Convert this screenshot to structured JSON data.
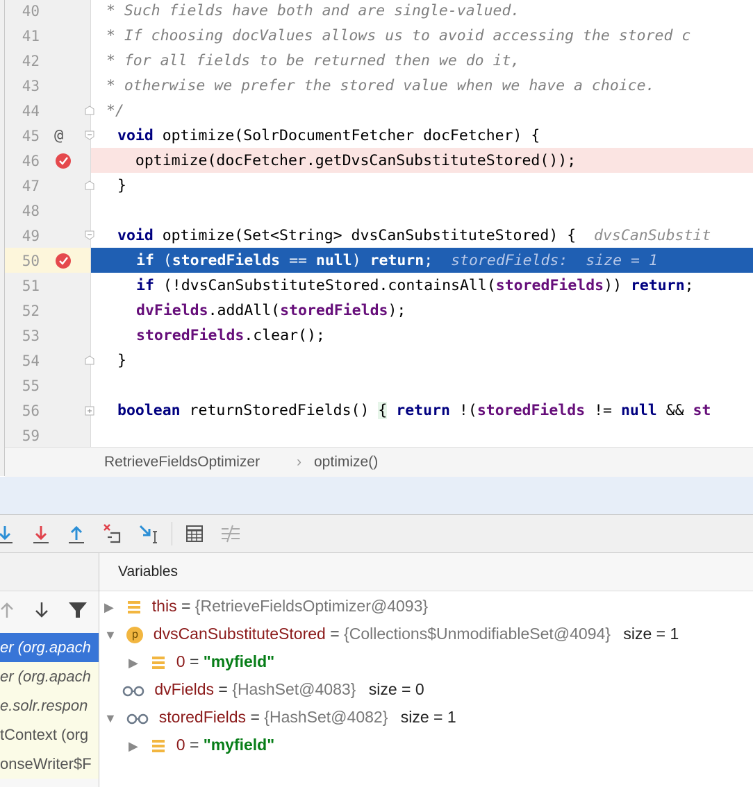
{
  "editor": {
    "lines": [
      {
        "num": "40",
        "type": "comment",
        "text": " * Such fields have both and are single-valued."
      },
      {
        "num": "41",
        "type": "comment",
        "text": " * If choosing docValues allows us to avoid accessing the stored c"
      },
      {
        "num": "42",
        "type": "comment",
        "text": " * for all fields to be returned then we do it,"
      },
      {
        "num": "43",
        "type": "comment",
        "text": " * otherwise we prefer the stored value when we have a choice."
      },
      {
        "num": "44",
        "type": "comment",
        "text": " */"
      },
      {
        "num": "45",
        "kw": "void",
        "rest": " optimize(SolrDocumentFetcher docFetcher) {"
      },
      {
        "num": "46",
        "text": "  optimize(docFetcher.getDvsCanSubstituteStored());"
      },
      {
        "num": "47",
        "text": "}"
      },
      {
        "num": "48",
        "text": ""
      },
      {
        "num": "49",
        "kw": "void",
        "rest": " optimize(Set<String> dvsCanSubstituteStored) {  ",
        "hint": "dvsCanSubstit"
      },
      {
        "num": "50"
      },
      {
        "num": "51"
      },
      {
        "num": "52"
      },
      {
        "num": "53"
      },
      {
        "num": "54",
        "text": "}"
      },
      {
        "num": "55",
        "text": ""
      },
      {
        "num": "56"
      },
      {
        "num": "59",
        "text": ""
      }
    ],
    "line50": {
      "if": "if",
      "p1": " (",
      "f1": "storedFields",
      "p2": " == ",
      "null": "null",
      "p3": ") ",
      "ret": "return",
      "p4": ";  ",
      "hint": "storedFields:  size = 1"
    },
    "line51": {
      "if": "if",
      "p1": " (!dvsCanSubstituteStored.containsAll(",
      "f1": "storedFields",
      "p2": ")) ",
      "ret": "return",
      "p3": ";"
    },
    "line52": {
      "f1": "dvFields",
      "p1": ".addAll(",
      "f2": "storedFields",
      "p2": ");"
    },
    "line53": {
      "f1": "storedFields",
      "p1": ".clear();"
    },
    "line56": {
      "kw": "boolean",
      "p1": " returnStoredFields() ",
      "brace": "{",
      "p2": " ",
      "ret": "return",
      "p3": " !(",
      "f1": "storedFields",
      "p4": " != ",
      "null": "null",
      "p5": " && ",
      "f2": "st"
    },
    "at_marker": "@"
  },
  "breadcrumb": {
    "class_name": "RetrieveFieldsOptimizer",
    "separator": "›",
    "method": "optimize()"
  },
  "variables_title": "Variables",
  "frames": [
    {
      "text": "er (org.apach",
      "selected": true
    },
    {
      "text": "er (org.apach",
      "selected": false
    },
    {
      "text": "e.solr.respon",
      "selected": false
    },
    {
      "text": "tContext (org",
      "selected": false
    },
    {
      "text": "onseWriter$F",
      "selected": false
    }
  ],
  "variables": [
    {
      "name": "this",
      "eq": " = ",
      "value": "{RetrieveFieldsOptimizer@4093}",
      "size": "",
      "icon": "field-icon",
      "expand": "collapsed"
    },
    {
      "name": "dvsCanSubstituteStored",
      "eq": " = ",
      "value": "{Collections$UnmodifiableSet@4094}",
      "size": "size = 1",
      "icon": "parameter-icon",
      "badge": "p",
      "expand": "expanded"
    },
    {
      "name": "0",
      "eq": " = ",
      "value": "\"myfield\"",
      "size": "",
      "icon": "field-icon",
      "expand": "collapsed",
      "child": true
    },
    {
      "name": "dvFields",
      "eq": " = ",
      "value": "{HashSet@4083}",
      "size": "size = 0",
      "icon": "watch-icon",
      "expand": "none"
    },
    {
      "name": "storedFields",
      "eq": " = ",
      "value": "{HashSet@4082}",
      "size": "size = 1",
      "icon": "watch-icon",
      "expand": "expanded"
    },
    {
      "name": "0",
      "eq": " = ",
      "value": "\"myfield\"",
      "size": "",
      "icon": "field-icon",
      "expand": "collapsed",
      "child": true
    }
  ],
  "colors": {
    "selection": "#1f5fb3",
    "breakpoint": "#e5494d",
    "breakpoint_line": "#fbe4e2",
    "accent": "#3875d7"
  }
}
